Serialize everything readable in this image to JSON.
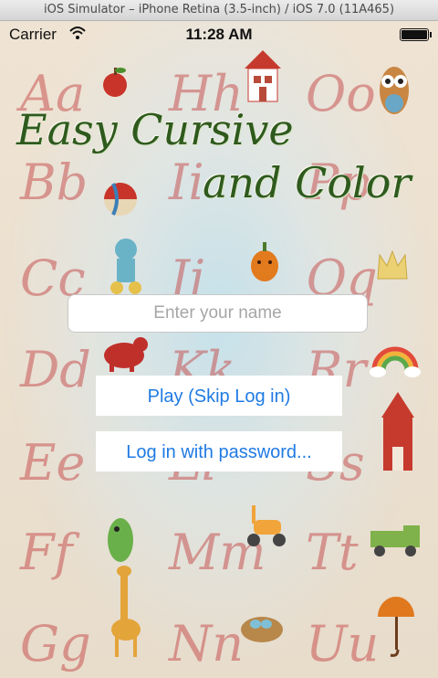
{
  "window": {
    "title": "iOS Simulator – iPhone Retina (3.5-inch) / iOS 7.0 (11A465)"
  },
  "status_bar": {
    "carrier": "Carrier",
    "time": "11:28 AM"
  },
  "app": {
    "title_line1": "Easy Cursive",
    "title_line2": "and Color",
    "title_color": "#2f5a1e"
  },
  "form": {
    "name_placeholder": "Enter your name",
    "name_value": "",
    "play_label": "Play (Skip Log in)",
    "login_label": "Log in with password...",
    "button_text_color": "#1f7ae3"
  },
  "background": {
    "letters": [
      "Aa",
      "Hh",
      "Oo",
      "Bb",
      "Ii",
      "Pp",
      "Cc",
      "Jj",
      "Qq",
      "Dd",
      "Kk",
      "Rr",
      "Ee",
      "Ll",
      "Ss",
      "Ff",
      "Mm",
      "Tt",
      "Gg",
      "Nn",
      "Uu"
    ]
  }
}
